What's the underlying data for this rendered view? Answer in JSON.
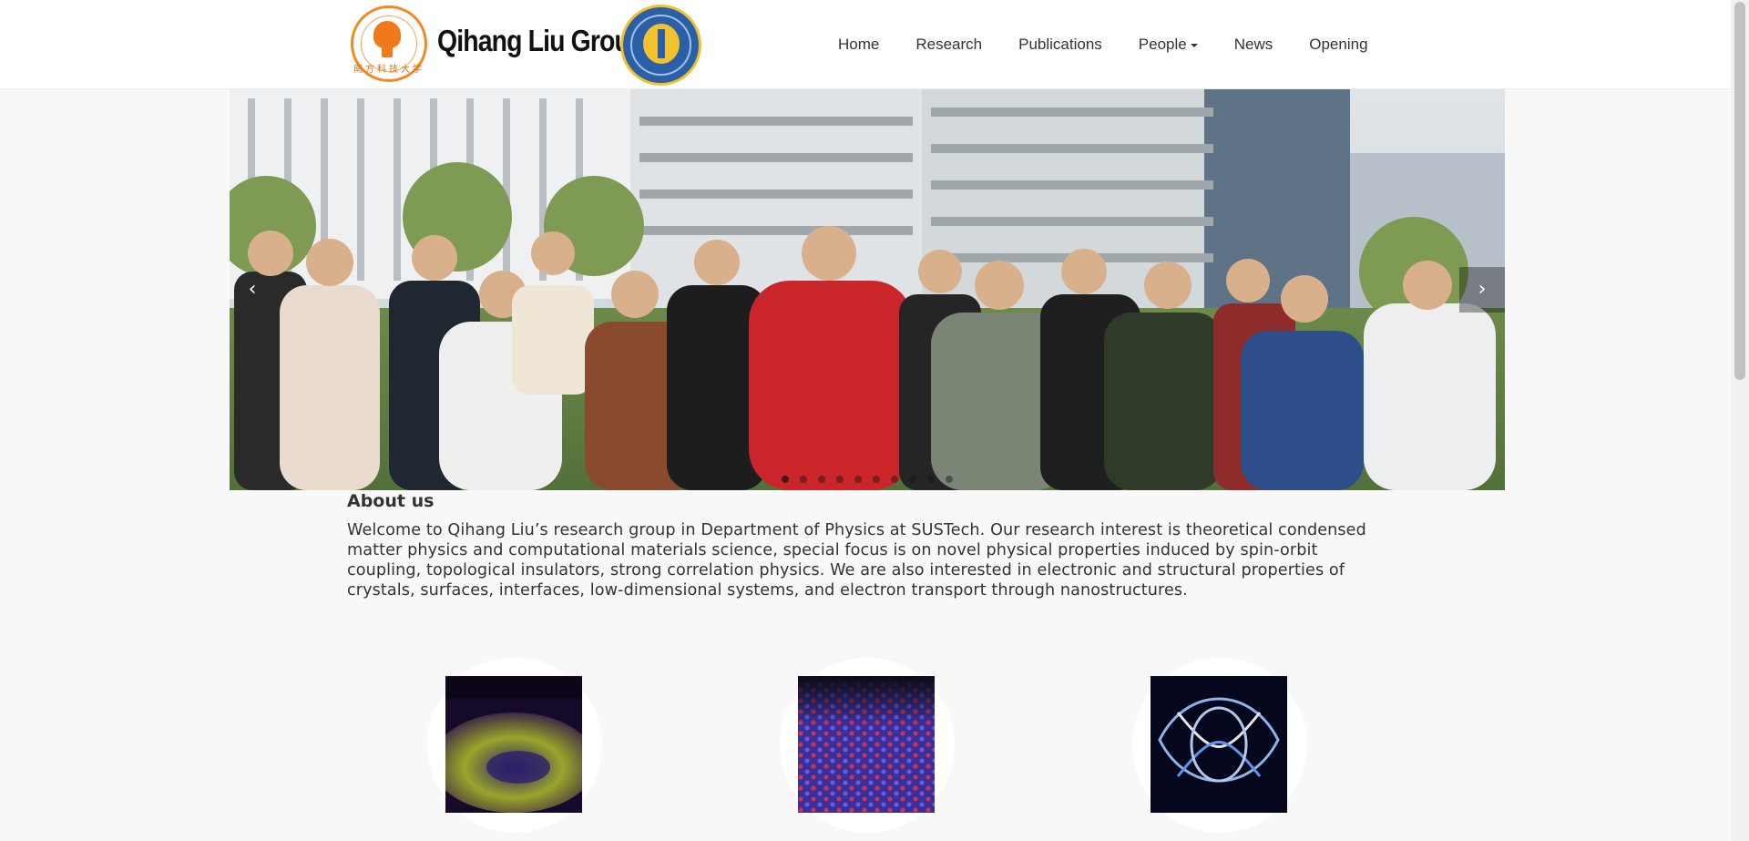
{
  "brand": {
    "name": "Qihang Liu Group",
    "left_logo_text": "南方科技大学"
  },
  "nav": {
    "items": [
      {
        "label": "Home"
      },
      {
        "label": "Research"
      },
      {
        "label": "Publications"
      },
      {
        "label": "People"
      },
      {
        "label": "News"
      },
      {
        "label": "Opening"
      }
    ]
  },
  "carousel": {
    "prev": "‹",
    "next": "›",
    "slide_count": 10,
    "active_index": 0
  },
  "about": {
    "title": "About us",
    "text": "Welcome to Qihang Liu’s research group in Department of Physics at SUSTech. Our research interest is theoretical condensed matter physics and computational materials science, special focus is on novel physical properties induced by spin-orbit coupling, topological insulators, strong correlation physics. We are also interested in electronic and structural properties of crystals, surfaces, interfaces, low-dimensional systems, and electron transport through nanostructures."
  },
  "research_cards": [
    {
      "icon": "band-structure-image"
    },
    {
      "icon": "lattice-image"
    },
    {
      "icon": "light-loops-image"
    }
  ],
  "colors": {
    "logo_orange": "#f08a24",
    "logo_blue": "#2b5fa6",
    "page_bg": "#f8f8f8"
  }
}
